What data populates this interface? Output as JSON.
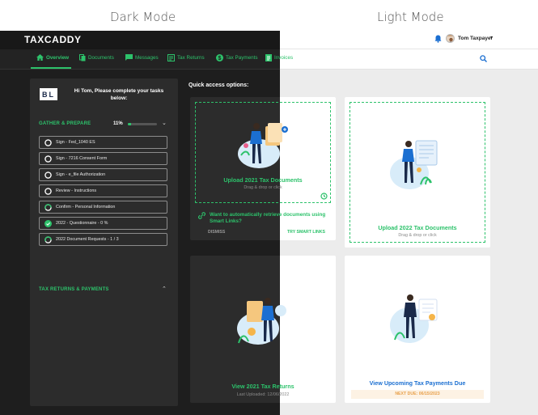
{
  "captions": {
    "dark": "Dark Mode",
    "light": "Light Mode"
  },
  "header": {
    "logo": "TAXCADDY",
    "user_name": "Tom Taxpayer",
    "user_caret": "▾"
  },
  "nav": {
    "overview": "Overview",
    "documents": "Documents",
    "messages": "Messages",
    "tax_returns": "Tax Returns",
    "tax_payments": "Tax Payments",
    "invoices": "Invoices"
  },
  "tasks_panel": {
    "firm_logo": "BL",
    "greeting": "Hi Tom, Please complete your tasks below:",
    "gather_title": "GATHER & PREPARE",
    "gather_percent": "11%",
    "gather_progress": 0.11,
    "tasks": [
      {
        "label": "Sign - Fed_1040 ES",
        "status": "empty"
      },
      {
        "label": "Sign - 7216 Consent Form",
        "status": "empty"
      },
      {
        "label": "Sign - e_file Authorization",
        "status": "empty"
      },
      {
        "label": "Review - Instructions",
        "status": "empty"
      },
      {
        "label": "Confirm - Personal Information",
        "status": "partial"
      },
      {
        "label": "2022 - Questionnaire - 0 %",
        "status": "done"
      },
      {
        "label": "2022 Document Requests - 1 / 3",
        "status": "partial"
      }
    ],
    "tax_title": "TAX RETURNS & PAYMENTS"
  },
  "quick": {
    "title": "Quick access options:",
    "upload21": {
      "title": "Upload 2021 Tax Documents",
      "sub": "Drag & drop or click",
      "smart_links": "Want to automatically retrieve documents using Smart Links?",
      "dismiss": "DISMISS",
      "try": "TRY SMART LINKS"
    },
    "upload22": {
      "title": "Upload 2022 Tax Documents",
      "sub": "Drag & drop or click"
    },
    "returns": {
      "title": "View 2021 Tax Returns",
      "sub": "Last Uploaded: 12/06/2022"
    },
    "payments": {
      "title": "View Upcoming Tax Payments Due",
      "next_due": "NEXT DUE: 06/15/2023"
    }
  },
  "colors": {
    "accent": "#2dc26b",
    "dark_bg": "#1e1e1e",
    "panel": "#2c2c2c",
    "light_bg": "#ececec"
  }
}
